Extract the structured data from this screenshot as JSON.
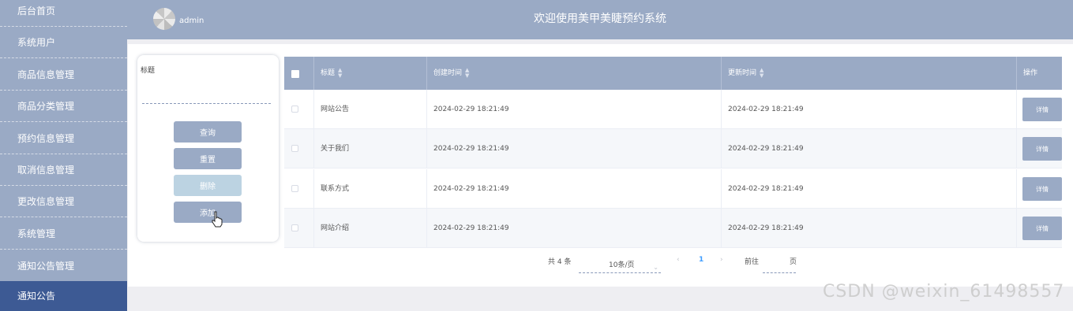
{
  "sidebar": {
    "items": [
      {
        "label": "后台首页"
      },
      {
        "label": "系统用户"
      },
      {
        "label": "商品信息管理"
      },
      {
        "label": "商品分类管理"
      },
      {
        "label": "预约信息管理"
      },
      {
        "label": "取消信息管理"
      },
      {
        "label": "更改信息管理"
      },
      {
        "label": "系统管理"
      },
      {
        "label": "通知公告管理"
      },
      {
        "label": "通知公告"
      }
    ]
  },
  "header": {
    "username": "admin",
    "title": "欢迎使用美甲美睫预约系统"
  },
  "search": {
    "field_label": "标题",
    "field_value": "",
    "buttons": {
      "query": "查询",
      "reset": "重置",
      "delete": "删除",
      "add": "添加"
    }
  },
  "table": {
    "columns": [
      "标题",
      "创建时间",
      "更新时间",
      "操作"
    ],
    "rows": [
      {
        "title": "网站公告",
        "created": "2024-02-29 18:21:49",
        "updated": "2024-02-29 18:21:49",
        "action": "详情"
      },
      {
        "title": "关于我们",
        "created": "2024-02-29 18:21:49",
        "updated": "2024-02-29 18:21:49",
        "action": "详情"
      },
      {
        "title": "联系方式",
        "created": "2024-02-29 18:21:49",
        "updated": "2024-02-29 18:21:49",
        "action": "详情"
      },
      {
        "title": "网站介绍",
        "created": "2024-02-29 18:21:49",
        "updated": "2024-02-29 18:21:49",
        "action": "详情"
      }
    ]
  },
  "pagination": {
    "total": "共 4 条",
    "page_size": "10条/页",
    "prev_icon": "chevron-left-icon",
    "current_page": "1",
    "next_icon": "chevron-right-icon",
    "goto_label": "前往",
    "goto_value": "",
    "page_suffix": "页"
  },
  "watermark": "CSDN @weixin_61498557",
  "colors": {
    "sidebar_bg": "#9aaac5",
    "sidebar_active": "#3d5a94",
    "accent": "#9aaac5",
    "delete_disabled": "#bcd3e2",
    "current_page": "#409eff"
  }
}
